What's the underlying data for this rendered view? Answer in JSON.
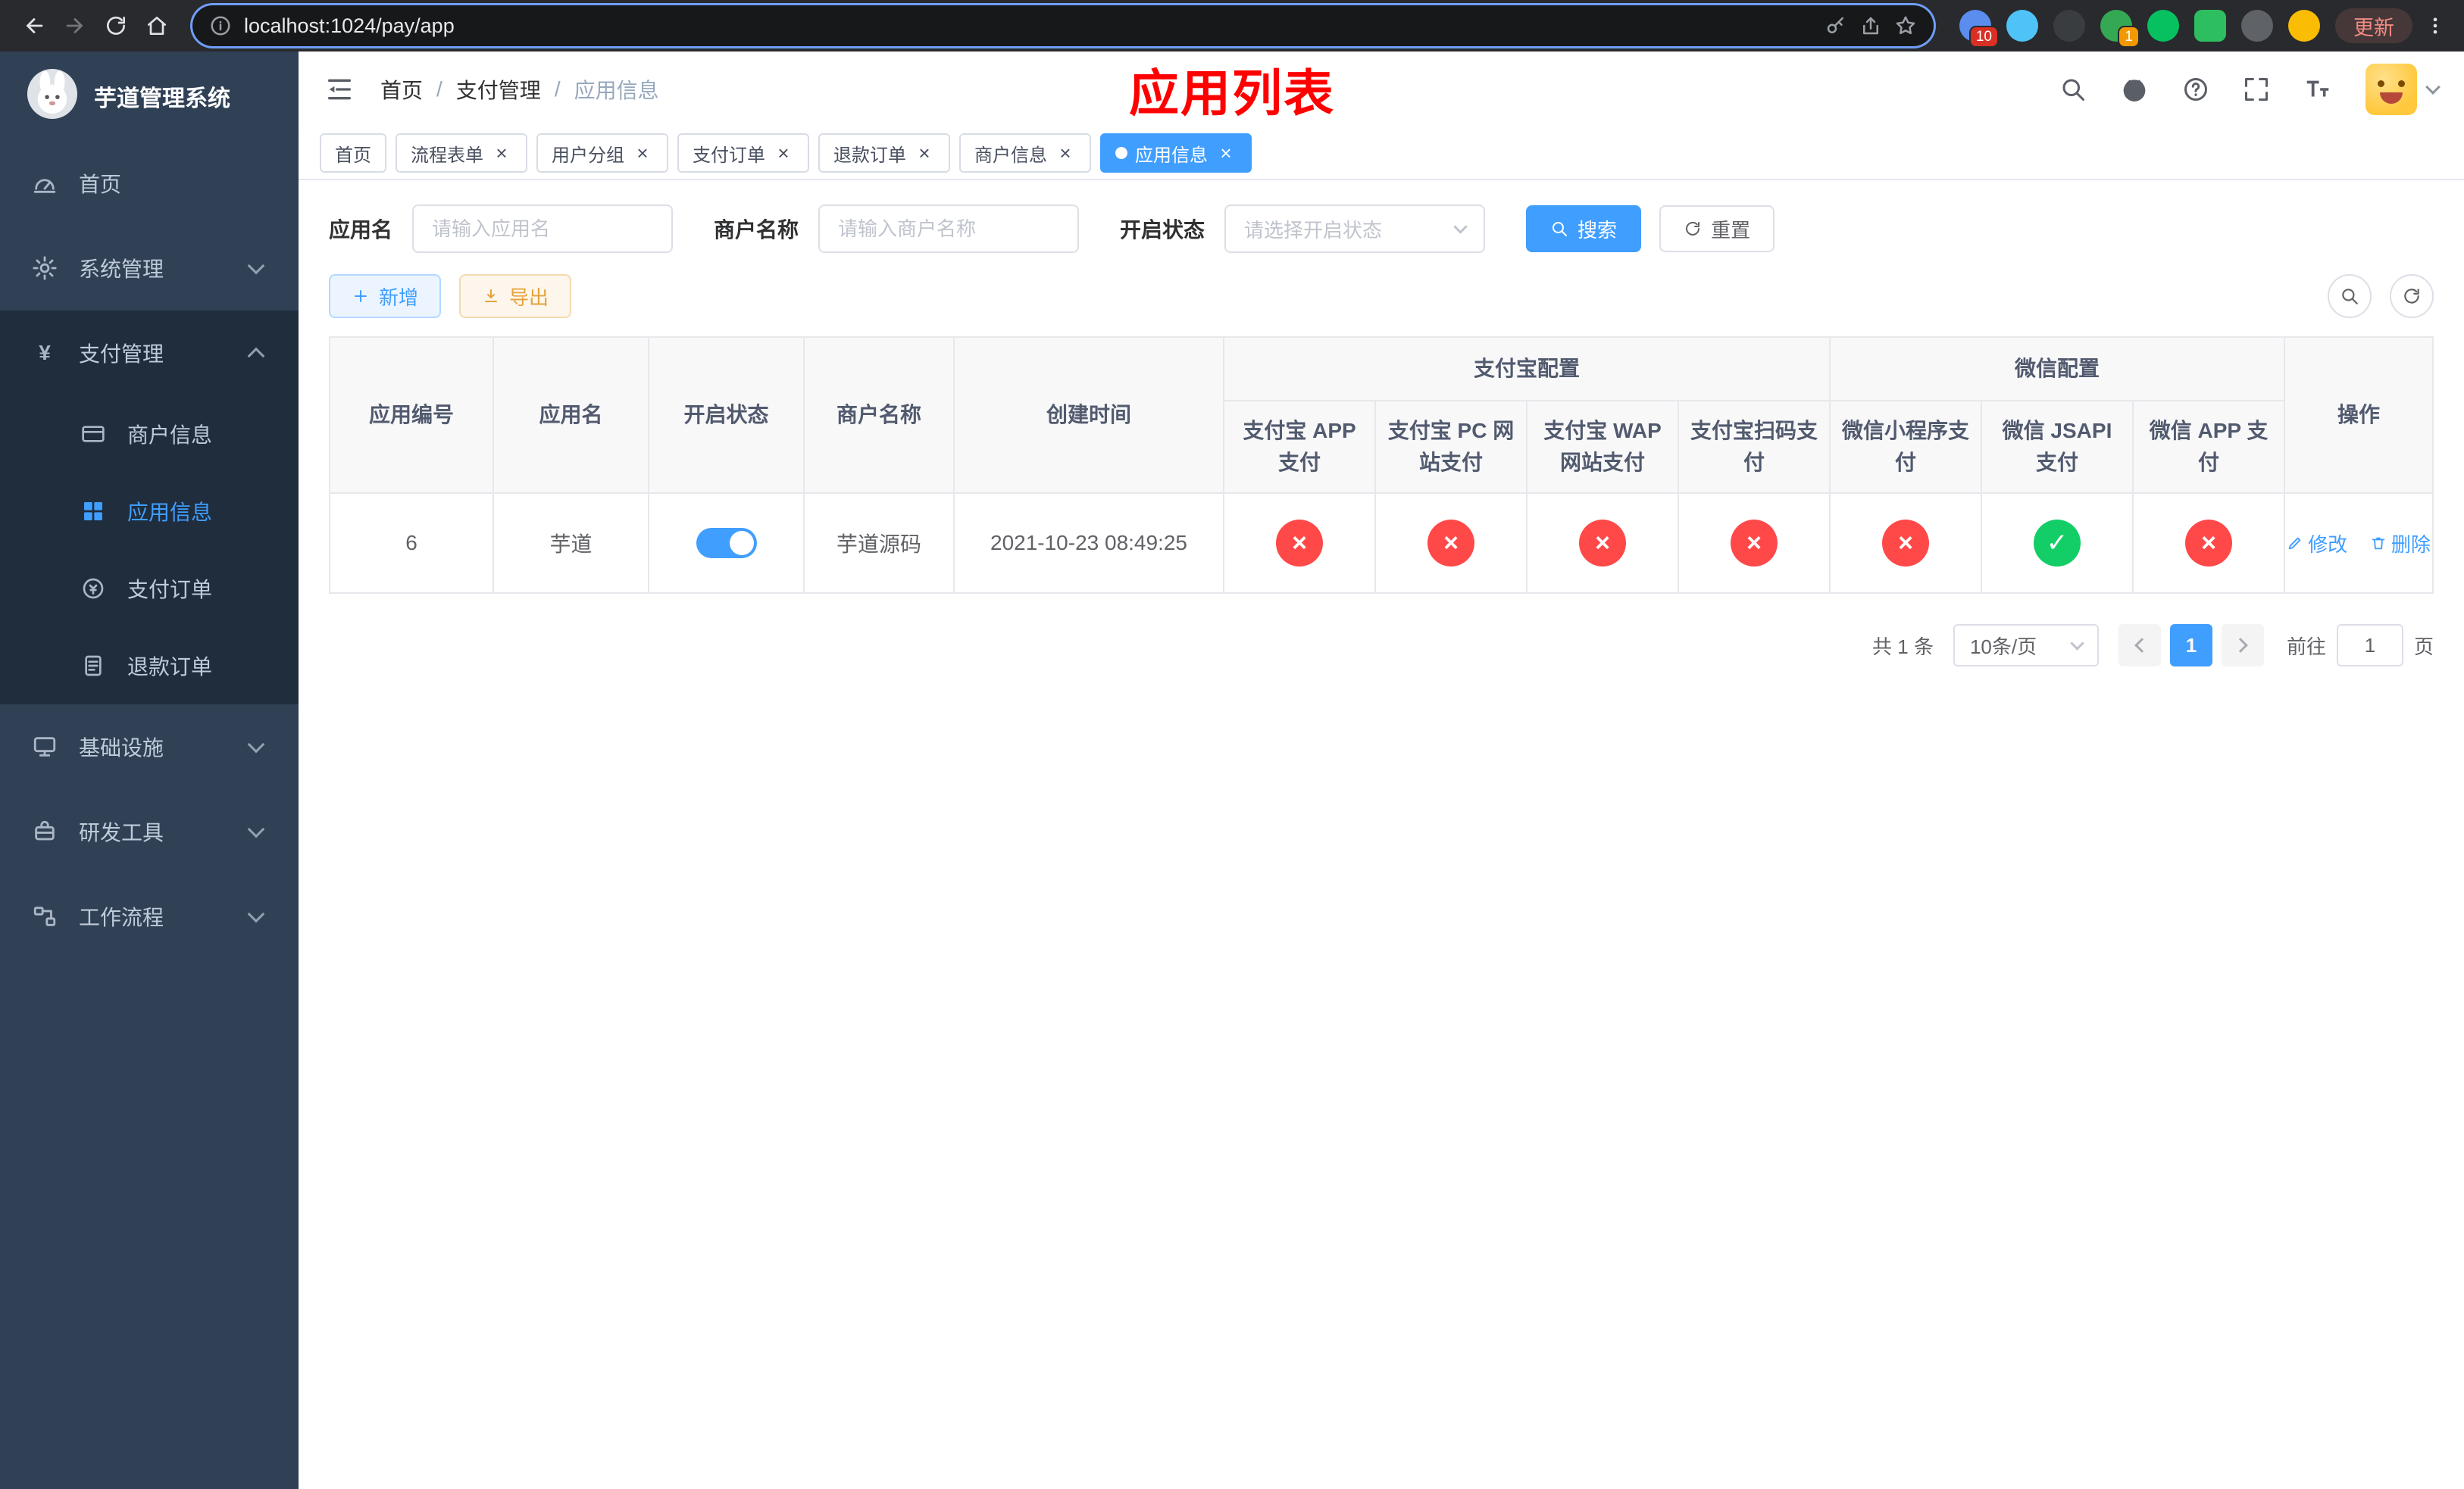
{
  "browser": {
    "url": "localhost:1024/pay/app",
    "update_label": "更新",
    "ext_badge_puzzle": "10",
    "ext_badge_translate": "1"
  },
  "sidebar": {
    "title": "芋道管理系统",
    "menu": [
      {
        "label": "首页"
      },
      {
        "label": "系统管理"
      },
      {
        "label": "支付管理"
      },
      {
        "label": "基础设施"
      },
      {
        "label": "研发工具"
      },
      {
        "label": "工作流程"
      }
    ],
    "payment_children": [
      {
        "label": "商户信息"
      },
      {
        "label": "应用信息"
      },
      {
        "label": "支付订单"
      },
      {
        "label": "退款订单"
      }
    ]
  },
  "header": {
    "breadcrumb": [
      "首页",
      "支付管理",
      "应用信息"
    ],
    "page_title": "应用列表"
  },
  "tabs": [
    {
      "label": "首页"
    },
    {
      "label": "流程表单"
    },
    {
      "label": "用户分组"
    },
    {
      "label": "支付订单"
    },
    {
      "label": "退款订单"
    },
    {
      "label": "商户信息"
    },
    {
      "label": "应用信息"
    }
  ],
  "filters": {
    "app_name_label": "应用名",
    "app_name_placeholder": "请输入应用名",
    "merchant_label": "商户名称",
    "merchant_placeholder": "请输入商户名称",
    "status_label": "开启状态",
    "status_placeholder": "请选择开启状态",
    "search_label": "搜索",
    "reset_label": "重置"
  },
  "toolbar": {
    "add_label": "新增",
    "export_label": "导出"
  },
  "table": {
    "columns": {
      "id": "应用编号",
      "name": "应用名",
      "enabled": "开启状态",
      "merchant": "商户名称",
      "created": "创建时间",
      "alipay_group": "支付宝配置",
      "wechat_group": "微信配置",
      "alipay": [
        "支付宝 APP 支付",
        "支付宝 PC 网站支付",
        "支付宝 WAP 网站支付",
        "支付宝扫码支付"
      ],
      "wechat": [
        "微信小程序支付",
        "微信 JSAPI 支付",
        "微信 APP 支付"
      ],
      "actions": "操作"
    },
    "rows": [
      {
        "id": "6",
        "name": "芋道",
        "enabled": true,
        "merchant": "芋道源码",
        "created": "2021-10-23 08:49:25",
        "alipay_app": false,
        "alipay_pc": false,
        "alipay_wap": false,
        "alipay_qr": false,
        "wx_lite": false,
        "wx_jsapi": true,
        "wx_app": false,
        "edit_label": "修改",
        "delete_label": "删除"
      }
    ]
  },
  "pagination": {
    "total": "共 1 条",
    "page_size": "10条/页",
    "current_page": "1",
    "goto_label": "前往",
    "goto_value": "1",
    "page_unit": "页"
  },
  "icons": {
    "back": "arrow-left",
    "forward": "arrow-right",
    "reload": "refresh",
    "home": "home",
    "info": "info-circle",
    "key": "key",
    "share": "share-up",
    "star": "star",
    "search": "magnifier",
    "github": "github",
    "help": "question-circle",
    "fullscreen": "expand-corners",
    "font_size": "text-size",
    "hamburger": "menu-fold",
    "add": "plus",
    "export": "download",
    "edit": "pencil",
    "delete": "trash",
    "enabled_true": "✓",
    "enabled_false": "×",
    "caret": "chevron-down"
  },
  "colors": {
    "accent": "#409EFF",
    "success": "#13ce66",
    "danger": "#ff4949",
    "warning": "#e6a23c",
    "title_red": "#ff0000",
    "sidebar_bg": "#304156",
    "submenu_bg": "#1f2d3d"
  }
}
